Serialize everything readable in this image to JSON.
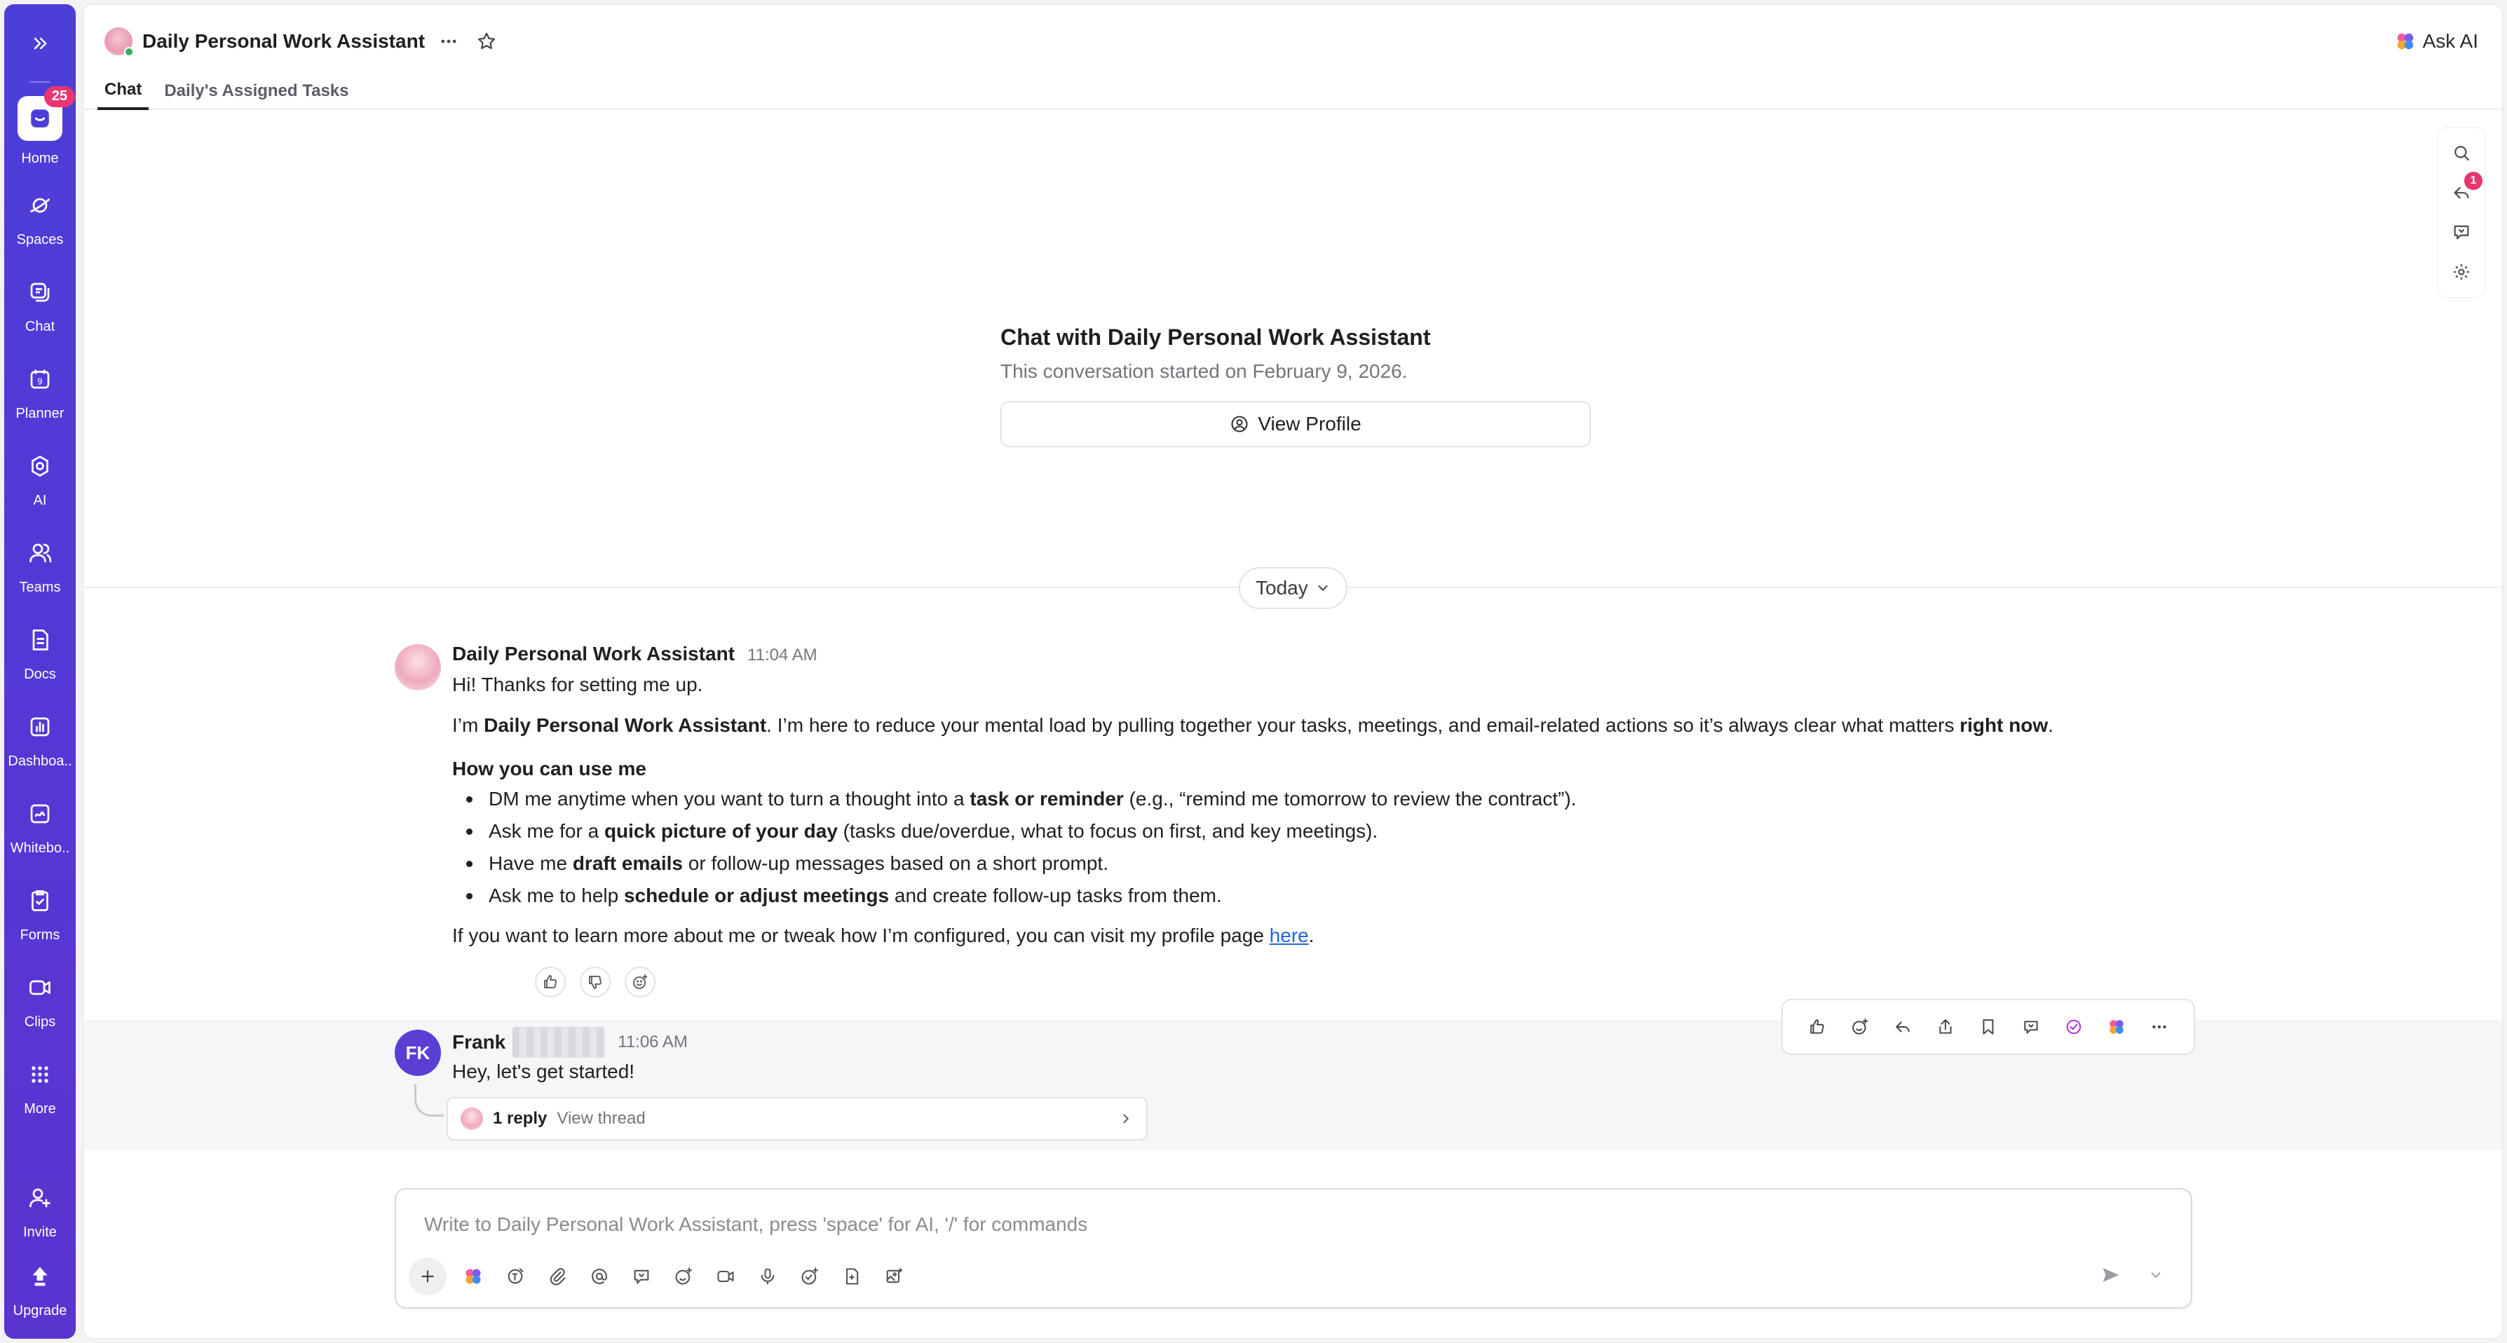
{
  "rail": {
    "items": [
      {
        "label": "Home",
        "badge": "25"
      },
      {
        "label": "Spaces"
      },
      {
        "label": "Chat"
      },
      {
        "label": "Planner"
      },
      {
        "label": "AI"
      },
      {
        "label": "Teams"
      },
      {
        "label": "Docs"
      },
      {
        "label": "Dashboa.."
      },
      {
        "label": "Whitebo.."
      },
      {
        "label": "Forms"
      },
      {
        "label": "Clips"
      },
      {
        "label": "More"
      }
    ],
    "invite": "Invite",
    "upgrade": "Upgrade"
  },
  "header": {
    "title": "Daily Personal Work Assistant",
    "ask_ai": "Ask AI",
    "tabs": [
      {
        "label": "Chat",
        "active": true
      },
      {
        "label": "Daily's Assigned Tasks",
        "active": false
      }
    ]
  },
  "side_tools": {
    "notification_badge": "1"
  },
  "intro": {
    "title": "Chat with Daily Personal Work Assistant",
    "subtitle": "This conversation started on February 9, 2026.",
    "view_profile": "View Profile"
  },
  "day_divider": "Today",
  "messages": {
    "bot": {
      "name": "Daily Personal Work Assistant",
      "time": "11:04 AM",
      "greeting": "Hi! Thanks for setting me up.",
      "intro_p1": "I’m ",
      "intro_bold1": "Daily Personal Work Assistant",
      "intro_p2": ". I’m here to reduce your mental load by pulling together your tasks, meetings, and email-related actions so it’s always clear what matters ",
      "intro_bold2": "right now",
      "intro_p3": ".",
      "howto_heading": "How you can use me",
      "bullets": [
        {
          "pre": "DM me anytime when you want to turn a thought into a ",
          "bold": "task or reminder",
          "post": " (e.g., “remind me tomorrow to review the contract”)."
        },
        {
          "pre": "Ask me for a ",
          "bold": "quick picture of your day",
          "post": " (tasks due/overdue, what to focus on first, and key meetings)."
        },
        {
          "pre": "Have me ",
          "bold": "draft emails",
          "post": " or follow-up messages based on a short prompt."
        },
        {
          "pre": "Ask me to help ",
          "bold": "schedule or adjust meetings",
          "post": " and create follow-up tasks from them."
        }
      ],
      "outro": "If you want to learn more about me or tweak how I’m configured, you can visit my profile page ",
      "outro_link": "here",
      "outro_end": "."
    },
    "user": {
      "initials": "FK",
      "name": "Frank",
      "time": "11:06 AM",
      "text": "Hey, let's get started!",
      "reply_count": "1 reply",
      "view_thread": "View thread"
    }
  },
  "composer": {
    "placeholder": "Write to Daily Personal Work Assistant, press 'space' for AI, '/' for commands"
  },
  "colors": {
    "rail": "#4b3fd8",
    "badge": "#e8366f",
    "link": "#2563d9",
    "avatar_fk": "#5b3fd5"
  }
}
